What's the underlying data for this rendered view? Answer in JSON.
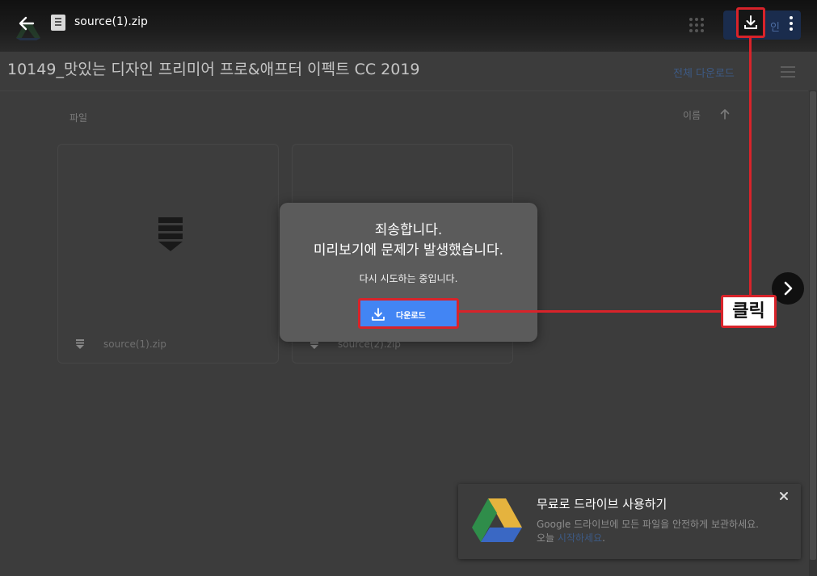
{
  "topbar": {
    "filename": "source(1).zip",
    "signin_label": "인",
    "icons": [
      "back-arrow-icon",
      "zip-file-icon",
      "apps-grid-icon",
      "download-icon",
      "more-vert-icon"
    ]
  },
  "folder": {
    "title": "10149_맛있는 디자인 프리미어 프로&애프터 이펙트 CC 2019",
    "download_all": "전체 다운로드"
  },
  "list": {
    "files_label": "파일",
    "sort_label": "이름",
    "items": [
      {
        "name": "source(1).zip"
      },
      {
        "name": "source(2).zip"
      }
    ]
  },
  "dialog": {
    "title_line1": "죄송합니다.",
    "title_line2": "미리보기에 문제가 발생했습니다.",
    "subtitle": "다시 시도하는 중입니다.",
    "download_label": "다운로드"
  },
  "annotation": {
    "label": "클릭",
    "color": "#d8232a"
  },
  "promo": {
    "title": "무료로 드라이브 사용하기",
    "body": "Google 드라이브에 모든 파일을 안전하게 보관하세요.",
    "body2_prefix": "오늘 ",
    "link": "시작하세요",
    "body2_suffix": "."
  },
  "colors": {
    "accent_blue": "#4285f4",
    "annotation_red": "#d8232a"
  }
}
